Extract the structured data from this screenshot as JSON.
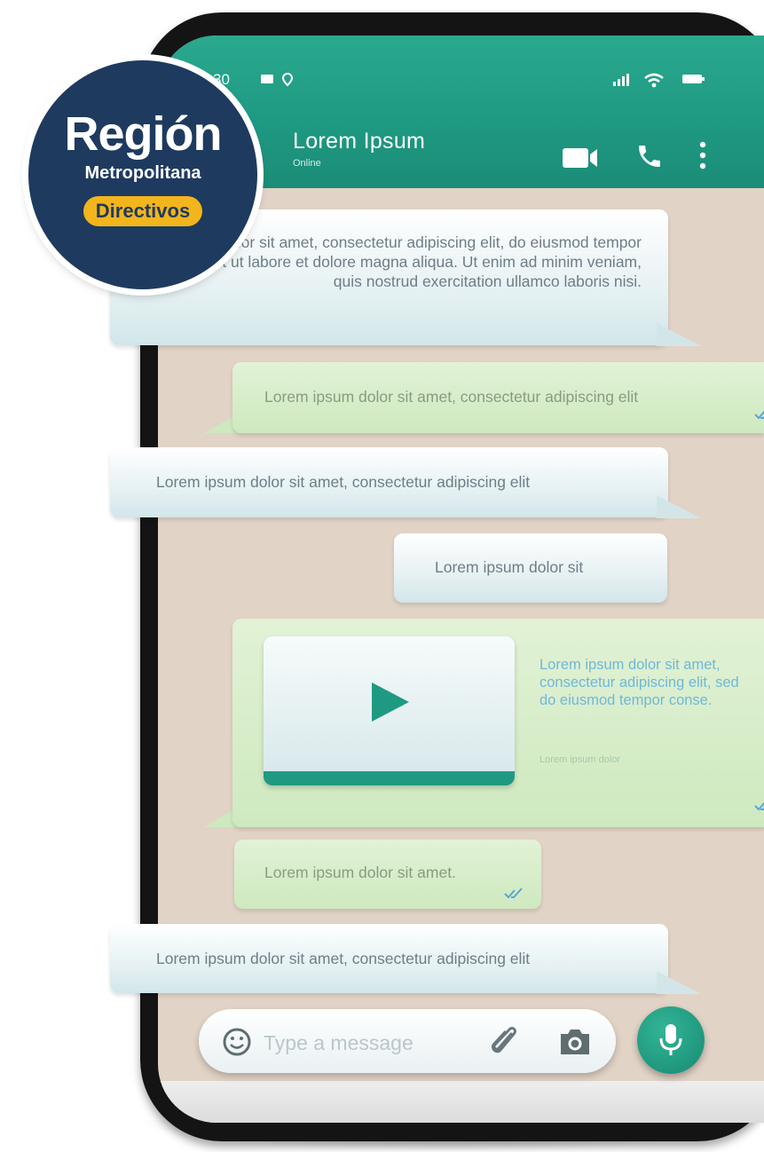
{
  "status_bar": {
    "time": "30"
  },
  "header": {
    "contact_name": "Lorem Ipsum",
    "contact_status": "Online"
  },
  "messages": [
    {
      "direction": "incoming",
      "text": "sum dolor sit amet, consectetur adipiscing elit, do eiusmod tempor incididunt ut labore et dolore magna aliqua. Ut enim ad minim veniam, quis nostrud exercitation ullamco laboris nisi."
    },
    {
      "direction": "outgoing",
      "text": "Lorem ipsum dolor sit amet, consectetur adipiscing elit"
    },
    {
      "direction": "incoming",
      "text": "Lorem ipsum dolor sit amet, consectetur adipiscing elit"
    },
    {
      "direction": "incoming",
      "text": "Lorem ipsum dolor sit"
    },
    {
      "direction": "outgoing",
      "type": "video",
      "caption": "Lorem ipsum dolor sit amet, consectetur adipiscing elit, sed do eiusmod tempor conse.",
      "subcaption": "Lorem ipsum dolor"
    },
    {
      "direction": "outgoing",
      "text": "Lorem ipsum dolor sit amet."
    },
    {
      "direction": "incoming",
      "text": "Lorem ipsum dolor sit amet, consectetur adipiscing elit"
    }
  ],
  "composer": {
    "placeholder": "Type a message"
  },
  "logo": {
    "title": "Región",
    "subtitle": "Metropolitana",
    "badge": "Directivos"
  },
  "icons": {
    "video_call": "video-camera-icon",
    "voice_call": "phone-icon",
    "menu": "more-vertical-icon",
    "emoji": "smiley-icon",
    "attach": "paperclip-icon",
    "camera": "camera-icon",
    "mic": "microphone-icon",
    "play": "play-icon"
  },
  "colors": {
    "header": "#1f9a82",
    "chat_background": "#e1d3c6",
    "incoming_bubble": "#e6f1f3",
    "outgoing_bubble": "#d6edc8",
    "accent": "#1f9a82",
    "logo_navy": "#1e3a5f",
    "logo_gold": "#f2b51b"
  }
}
